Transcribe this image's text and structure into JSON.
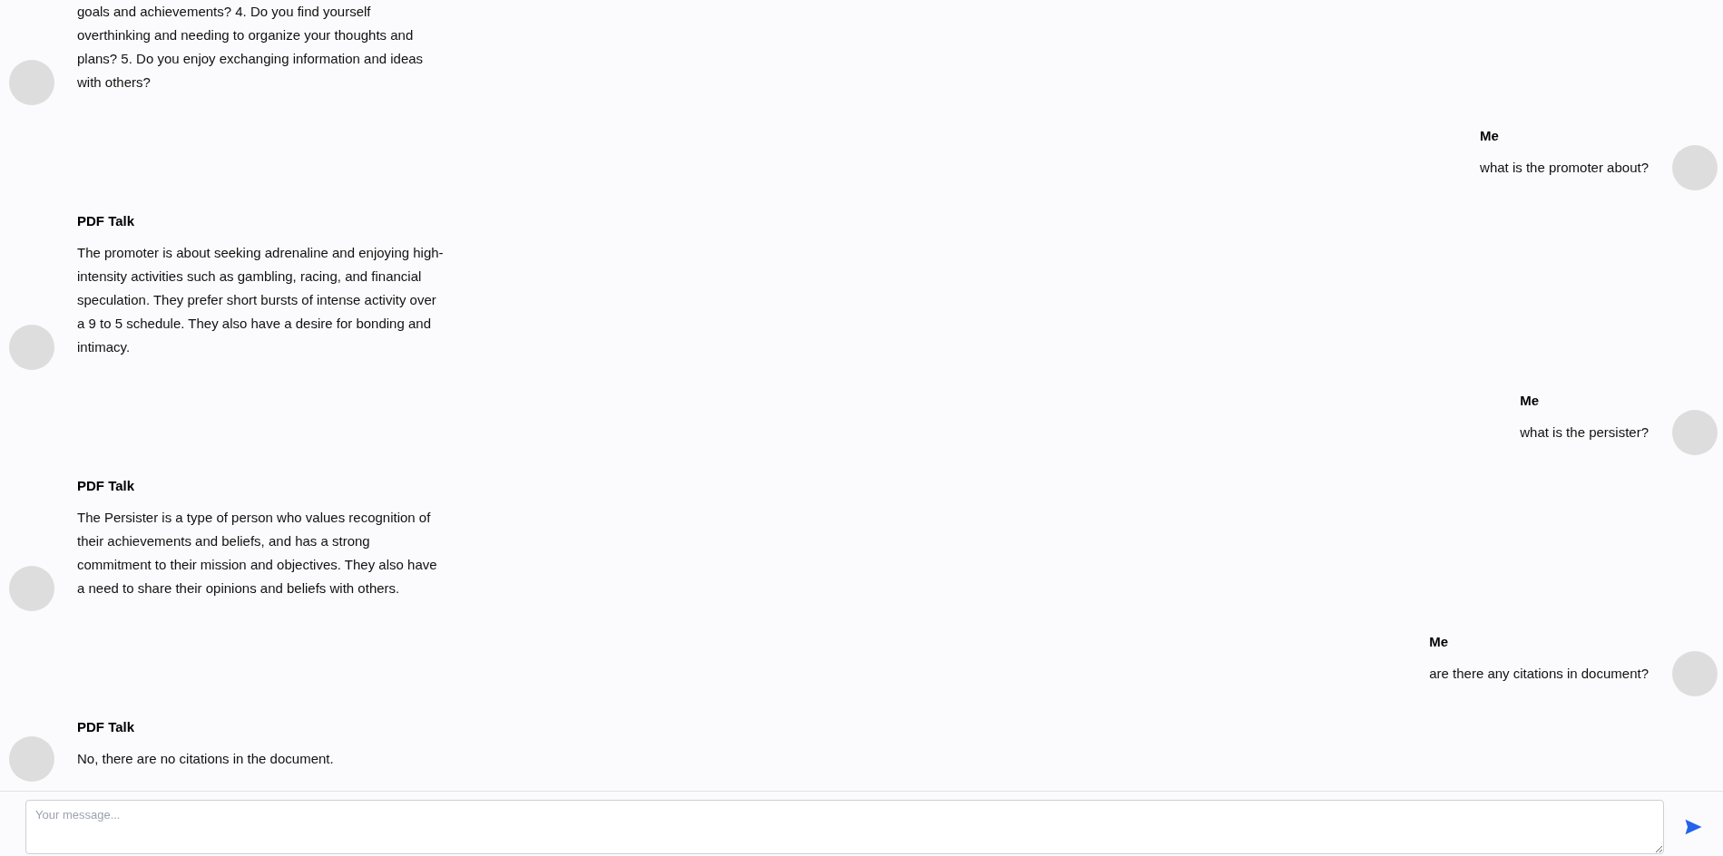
{
  "messages": [
    {
      "kind": "bot",
      "text": "goals and achievements? 4. Do you find yourself overthinking and needing to organize your thoughts and plans? 5. Do you enjoy exchanging information and ideas with others?"
    },
    {
      "kind": "user",
      "sender": "Me",
      "text": "what is the promoter about?"
    },
    {
      "kind": "bot",
      "sender": "PDF Talk",
      "text": "The promoter is about seeking adrenaline and enjoying high-intensity activities such as gambling, racing, and financial speculation. They prefer short bursts of intense activity over a 9 to 5 schedule. They also have a desire for bonding and intimacy."
    },
    {
      "kind": "user",
      "sender": "Me",
      "text": "what is the persister?"
    },
    {
      "kind": "bot",
      "sender": "PDF Talk",
      "text": "The Persister is a type of person who values recognition of their achievements and beliefs, and has a strong commitment to their mission and objectives. They also have a need to share their opinions and beliefs with others."
    },
    {
      "kind": "user",
      "sender": "Me",
      "text": "are there any citations in document?"
    },
    {
      "kind": "bot",
      "sender": "PDF Talk",
      "text": "No, there are no citations in the document."
    }
  ],
  "composer": {
    "placeholder": "Your message..."
  }
}
